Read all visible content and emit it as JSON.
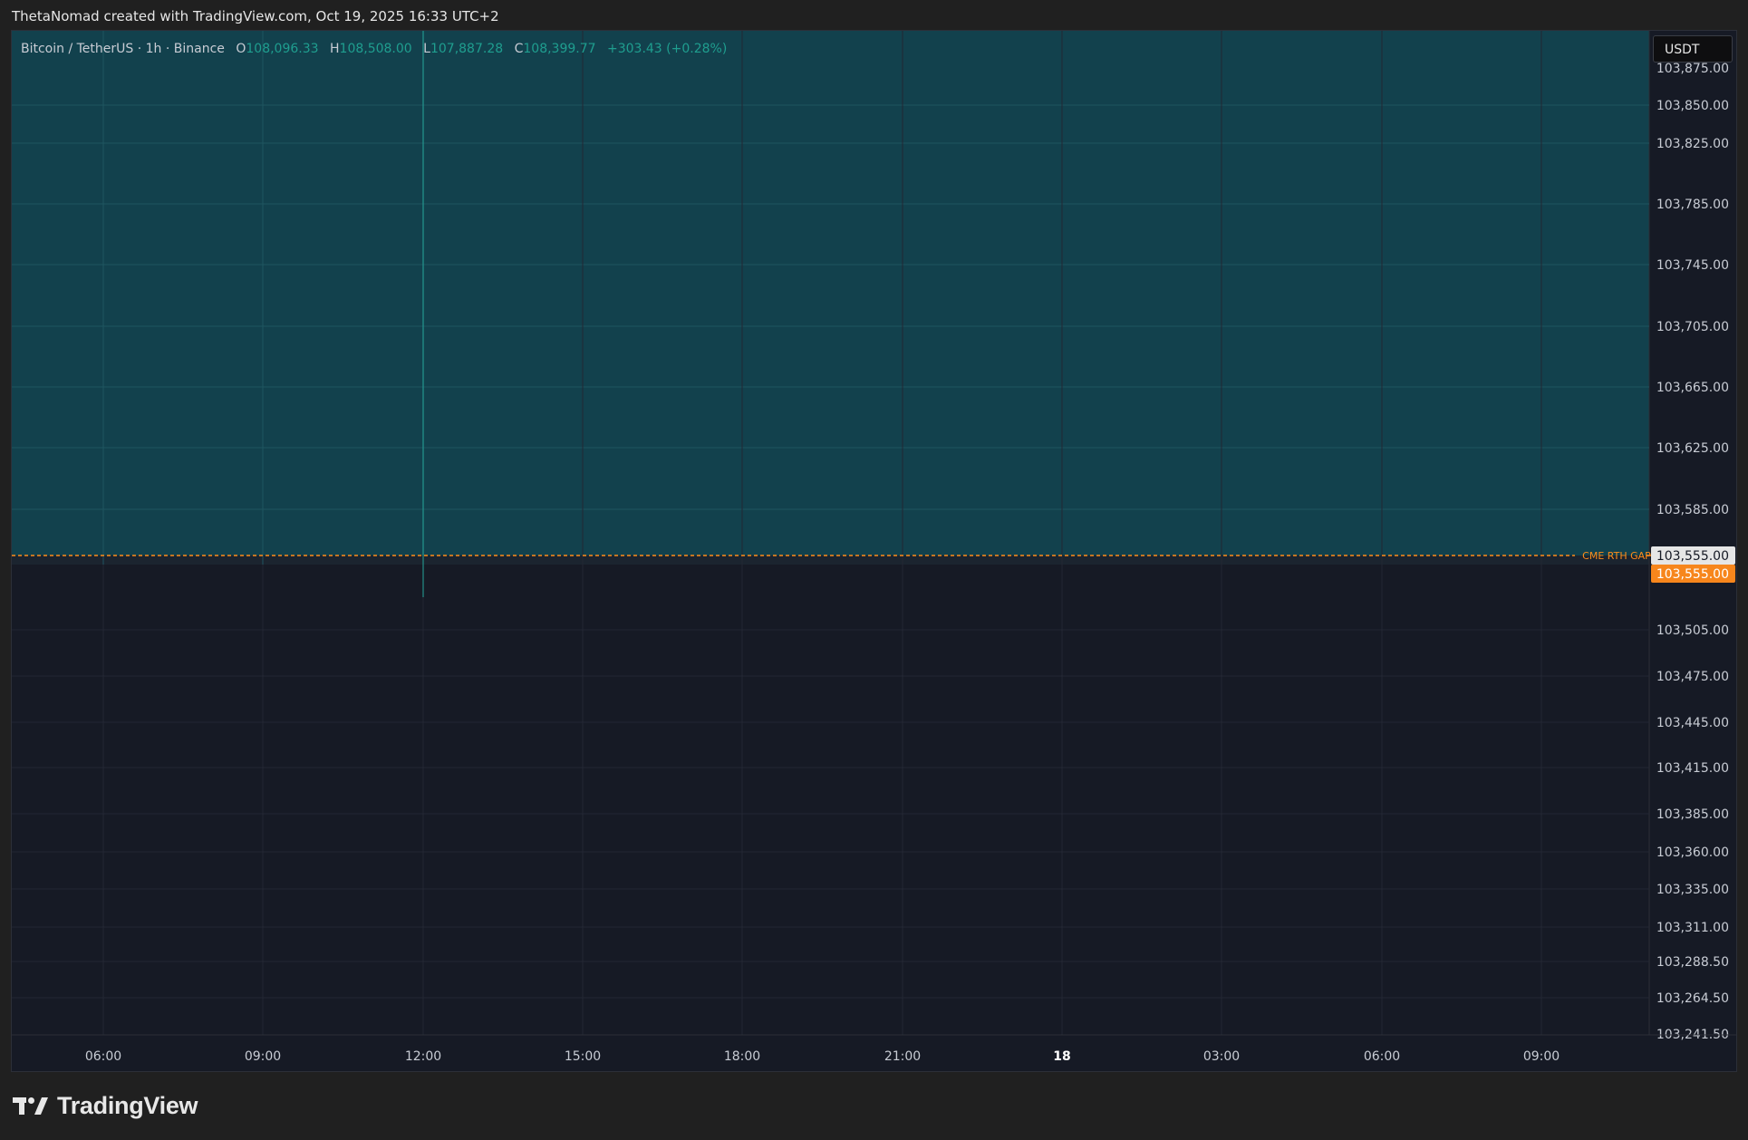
{
  "header": {
    "text": "ThetaNomad created with TradingView.com, Oct 19, 2025 16:33 UTC+2"
  },
  "legend": {
    "symbol": "Bitcoin / TetherUS · 1h · Binance",
    "open_label": "O",
    "open_value": "108,096.33",
    "high_label": "H",
    "high_value": "108,508.00",
    "low_label": "L",
    "low_value": "107,887.28",
    "close_label": "C",
    "close_value": "108,399.77",
    "change": "+303.43 (+0.28%)"
  },
  "currency": "USDT",
  "footer": {
    "brand": "TradingView"
  },
  "colors": {
    "background": "#161a25",
    "shaded_zone": "#12414d",
    "level_line": "#ff8c1a",
    "up_text": "#1f9e8f",
    "cursor_line": "#26a69a"
  },
  "chart_data": {
    "type": "line",
    "title": "Bitcoin / TetherUS · 1h · Binance",
    "x_ticks": [
      {
        "label": "06:00",
        "bold": false
      },
      {
        "label": "09:00",
        "bold": false
      },
      {
        "label": "12:00",
        "bold": false
      },
      {
        "label": "15:00",
        "bold": false
      },
      {
        "label": "18:00",
        "bold": false
      },
      {
        "label": "21:00",
        "bold": false
      },
      {
        "label": "18",
        "bold": true
      },
      {
        "label": "03:00",
        "bold": false
      },
      {
        "label": "06:00",
        "bold": false
      },
      {
        "label": "09:00",
        "bold": false
      }
    ],
    "y_ticks": [
      "103,850.00",
      "103,825.00",
      "103,785.00",
      "103,745.00",
      "103,705.00",
      "103,665.00",
      "103,625.00",
      "103,585.00",
      "103,505.00",
      "103,475.00",
      "103,445.00",
      "103,415.00",
      "103,385.00",
      "103,360.00",
      "103,335.00",
      "103,311.00",
      "103,288.50",
      "103,264.50",
      "103,241.50"
    ],
    "y_top_partial_label": "103,875.00",
    "levels": [
      {
        "name": "CME RTH GAP",
        "value": "103,555.00",
        "color": "#ff8c1a"
      }
    ],
    "price_tags": [
      {
        "value": "103,555.00",
        "style": "light"
      },
      {
        "value": "103,555.00",
        "style": "orange"
      }
    ],
    "shaded_zone": {
      "from": "103,555.00",
      "to": "top",
      "color": "#12414d"
    },
    "cursor_x_label": "12:00",
    "grid": true
  }
}
